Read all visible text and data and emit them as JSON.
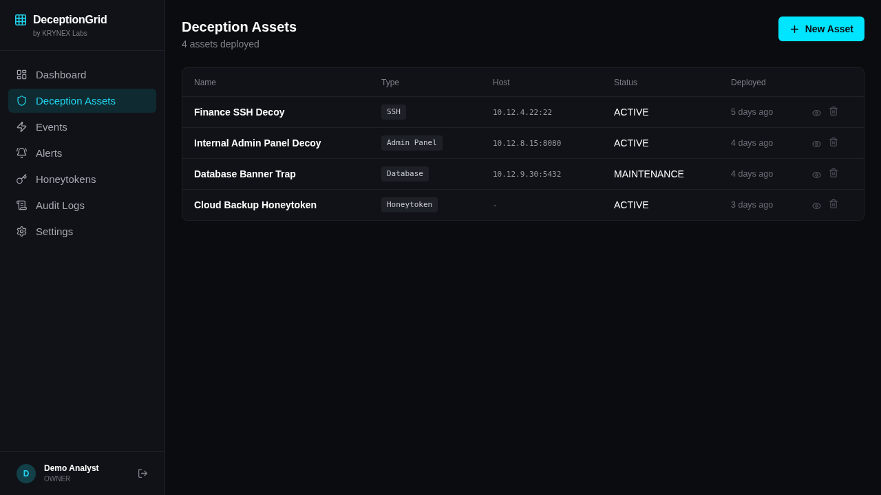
{
  "sidebar": {
    "brand": {
      "name": "DeceptionGrid",
      "byline": "by KRYNEX Labs"
    },
    "nav": [
      {
        "label": "Dashboard",
        "selected": false
      },
      {
        "label": "Deception Assets",
        "selected": true
      },
      {
        "label": "Events",
        "selected": false
      },
      {
        "label": "Alerts",
        "selected": false
      },
      {
        "label": "Honeytokens",
        "selected": false
      },
      {
        "label": "Audit Logs",
        "selected": false
      },
      {
        "label": "Settings",
        "selected": false
      }
    ],
    "user": {
      "initial": "D",
      "name": "Demo Analyst",
      "role": "OWNER"
    }
  },
  "header": {
    "title": "Deception Assets",
    "subtitle": "4 assets deployed",
    "button": "New Asset"
  },
  "table": {
    "columns": [
      "Name",
      "Type",
      "Host",
      "Status",
      "Deployed"
    ],
    "rows": [
      {
        "name": "Finance SSH Decoy",
        "type": "SSH",
        "host": "10.12.4.22:22",
        "status": "ACTIVE",
        "deployed": "5 days ago"
      },
      {
        "name": "Internal Admin Panel Decoy",
        "type": "Admin Panel",
        "host": "10.12.8.15:8080",
        "status": "ACTIVE",
        "deployed": "4 days ago"
      },
      {
        "name": "Database Banner Trap",
        "type": "Database",
        "host": "10.12.9.30:5432",
        "status": "MAINTENANCE",
        "deployed": "4 days ago"
      },
      {
        "name": "Cloud Backup Honeytoken",
        "type": "Honeytoken",
        "host": "-",
        "status": "ACTIVE",
        "deployed": "3 days ago"
      }
    ]
  }
}
